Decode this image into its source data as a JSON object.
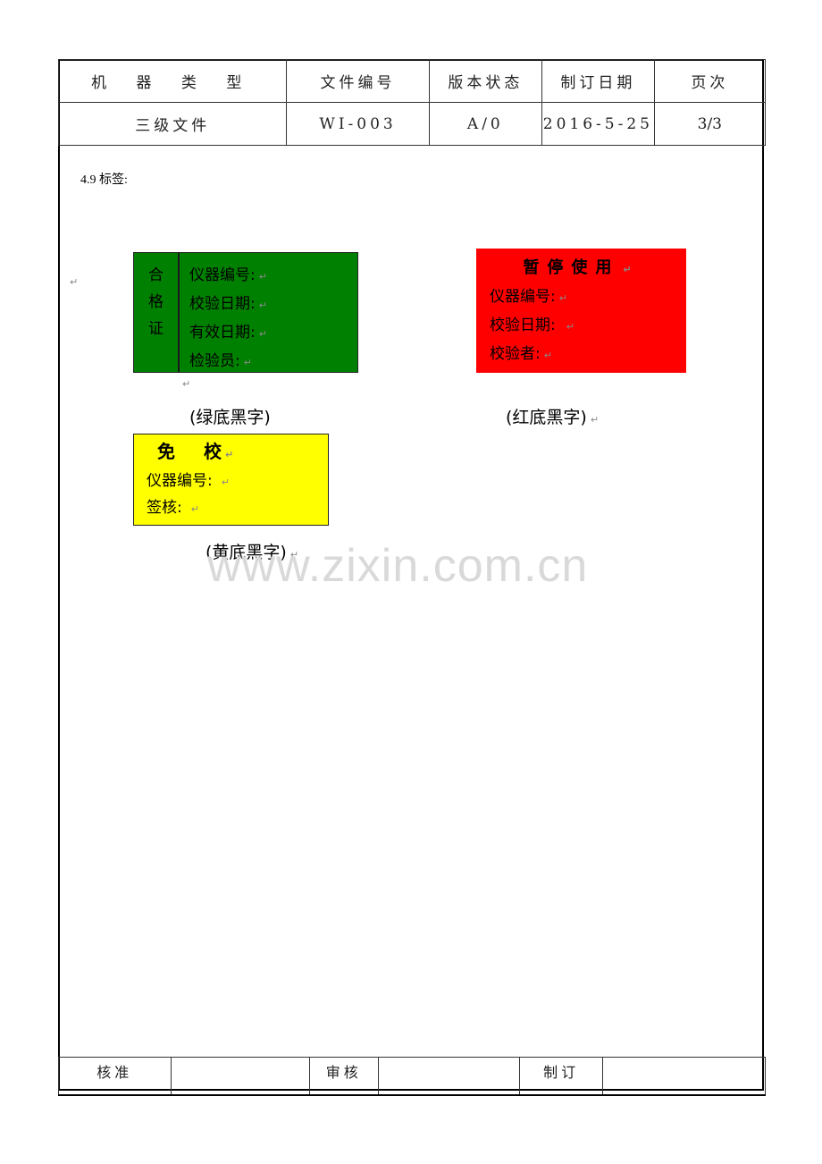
{
  "header": {
    "columns": [
      "机 器 类 型",
      "文件编号",
      "版本状态",
      "制订日期",
      "页次"
    ],
    "values": [
      "三级文件",
      "WI-003",
      "A/0",
      "2016-5-25",
      "3/3"
    ]
  },
  "section": {
    "title": "4.9 标签:"
  },
  "labels": {
    "green": {
      "side_chars": [
        "合",
        "格",
        "证"
      ],
      "lines": [
        "仪器编号:",
        "校验日期:",
        "有效日期:",
        "检验员:"
      ],
      "caption": "(绿底黑字)",
      "background": "#008000"
    },
    "red": {
      "title": "暂停使用",
      "lines": [
        "仪器编号:",
        "校验日期:",
        "校验者:"
      ],
      "caption": "(红底黑字)",
      "background": "#ff0000"
    },
    "yellow": {
      "title_chars": [
        "免",
        "校"
      ],
      "lines": [
        "仪器编号:",
        "签核:"
      ],
      "caption": "(黄底黑字)",
      "background": "#ffff00"
    }
  },
  "watermark": "www.zixin.com.cn",
  "return_mark": "↵",
  "footer": {
    "cells": [
      "核准",
      "",
      "审核",
      "",
      "制订",
      ""
    ]
  }
}
